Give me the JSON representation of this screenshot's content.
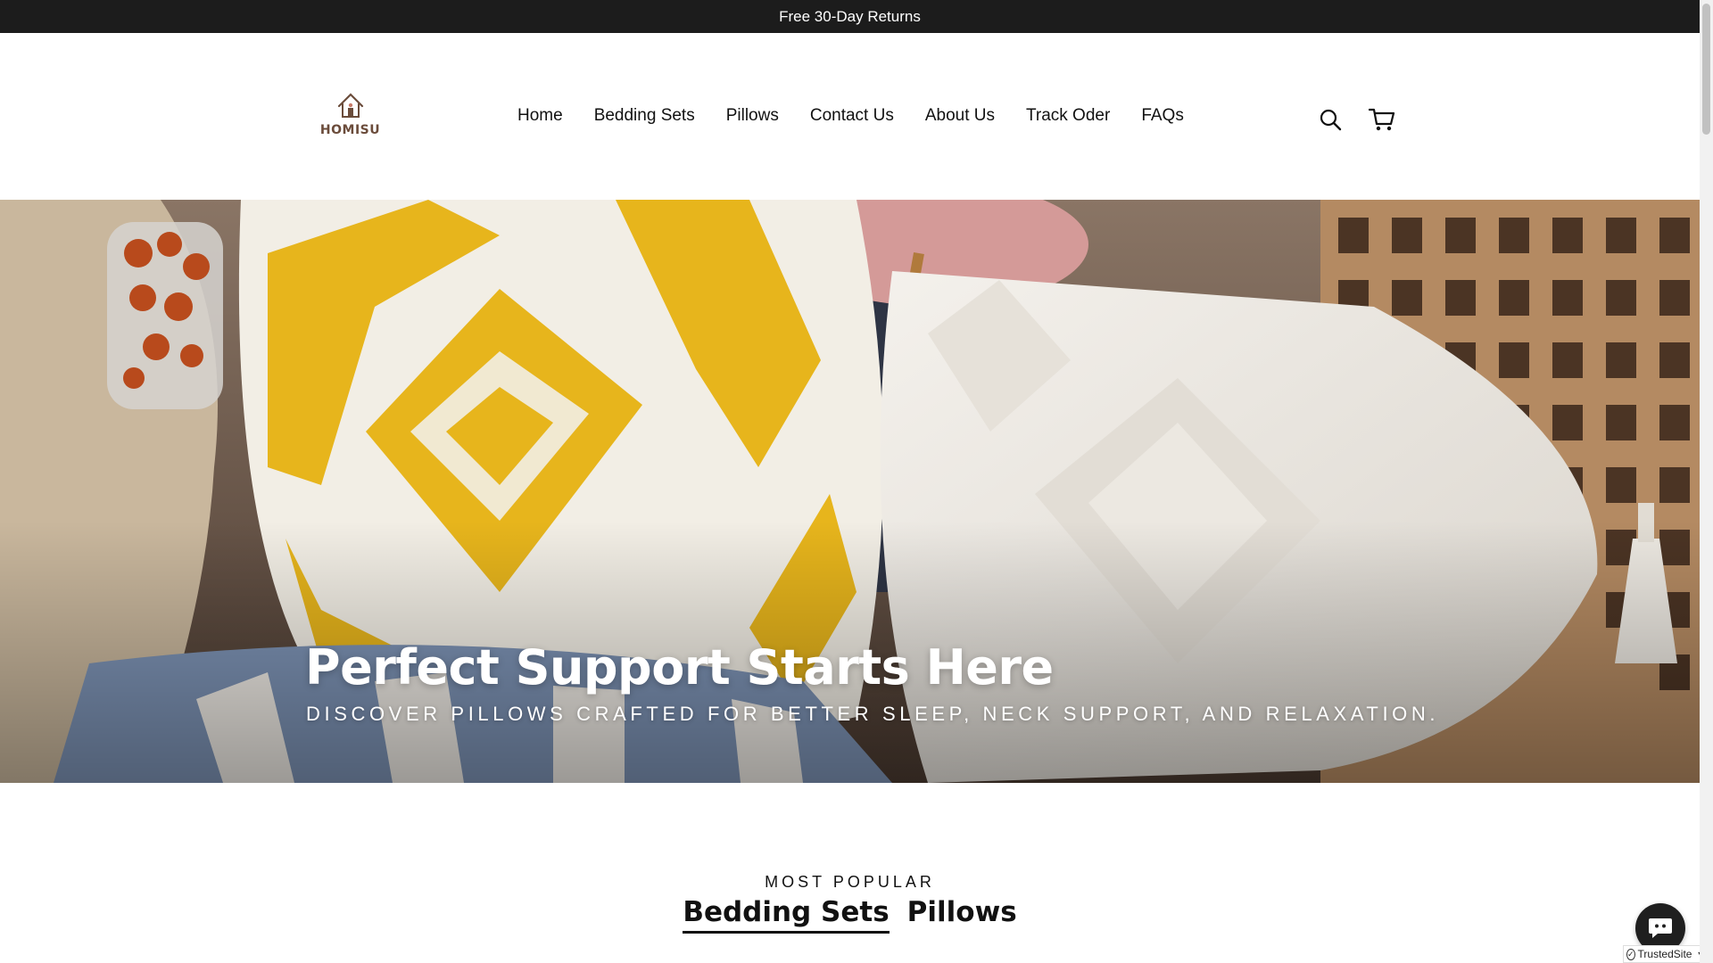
{
  "announcement": {
    "text": "Free 30-Day Returns"
  },
  "header": {
    "logo_text": "HOMISU",
    "nav": [
      {
        "label": "Home"
      },
      {
        "label": "Bedding Sets"
      },
      {
        "label": "Pillows"
      },
      {
        "label": "Contact Us"
      },
      {
        "label": "About Us"
      },
      {
        "label": "Track Oder"
      },
      {
        "label": "FAQs"
      }
    ],
    "icons": {
      "search": "search-icon",
      "cart": "cart-icon"
    }
  },
  "hero": {
    "title": "Perfect Support Starts Here",
    "subtitle": "Discover pillows crafted for better sleep, neck support, and relaxation."
  },
  "popular": {
    "label": "MOST POPULAR",
    "tabs": [
      {
        "label": "Bedding Sets",
        "active": true
      },
      {
        "label": "Pillows",
        "active": false
      }
    ]
  },
  "widgets": {
    "trusted_site": "TrustedSite",
    "chat_icon": "chat-bubble-icon"
  },
  "colors": {
    "announcement_bg": "#1c1c1c",
    "text": "#111111",
    "logo_brown": "#6b4c3b",
    "pillow_yellow": "#e7b51c",
    "pillow_blue": "#7d93b5"
  }
}
